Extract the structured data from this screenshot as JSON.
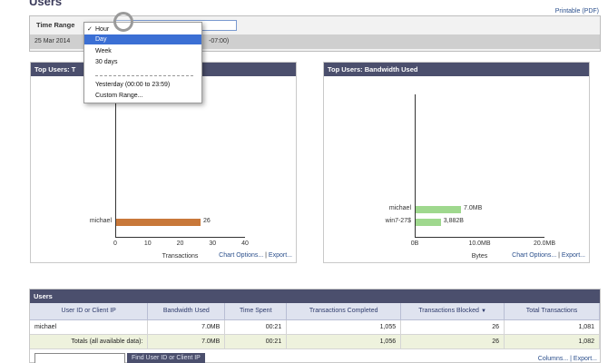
{
  "page": {
    "title": "Users",
    "printable": "Printable (PDF)"
  },
  "time_range": {
    "label": "Time Range",
    "date_text": "25 Mar 2014",
    "tz_text": "-07:00)",
    "options": [
      "Hour",
      "Day",
      "Week",
      "30 days",
      "Yesterday (00:00 to 23:59)",
      "Custom Range..."
    ],
    "checked": "Hour",
    "highlighted": "Day"
  },
  "panels": {
    "transactions": {
      "title": "Top Users: T",
      "links": {
        "options": "Chart Options...",
        "sep": " | ",
        "export": "Export..."
      }
    },
    "bandwidth": {
      "title": "Top Users: Bandwidth Used",
      "links": {
        "options": "Chart Options...",
        "sep": " | ",
        "export": "Export..."
      }
    }
  },
  "chart_data": [
    {
      "type": "bar",
      "orientation": "horizontal",
      "categories": [
        "michael"
      ],
      "values": [
        26
      ],
      "data_labels": [
        "26"
      ],
      "xlabel": "Transactions",
      "xlim": [
        0,
        40
      ],
      "xticks": [
        "0",
        "10",
        "20",
        "30",
        "40"
      ],
      "color": "#c8783a"
    },
    {
      "type": "bar",
      "orientation": "horizontal",
      "categories": [
        "michael",
        "win7-27$"
      ],
      "values": [
        7.0,
        3.882
      ],
      "data_labels": [
        "7.0MB",
        "3,882B"
      ],
      "xlabel": "Bytes",
      "xlim": [
        0,
        20
      ],
      "xticks": [
        "0B",
        "10.0MB",
        "20.0MB"
      ],
      "color": "#9fd88e"
    }
  ],
  "users_table": {
    "title": "Users",
    "columns": [
      "User ID or Client IP",
      "Bandwidth Used",
      "Time Spent",
      "Transactions Completed",
      "Transactions Blocked",
      "Total Transactions"
    ],
    "rows": [
      [
        "michael",
        "7.0MB",
        "00:21",
        "1,055",
        "26",
        "1,081"
      ]
    ],
    "totals": [
      "Totals (all available data):",
      "7.0MB",
      "00:21",
      "1,056",
      "26",
      "1,082"
    ],
    "find_button": "Find User ID or Client IP",
    "links": "Columns... | Export..."
  }
}
